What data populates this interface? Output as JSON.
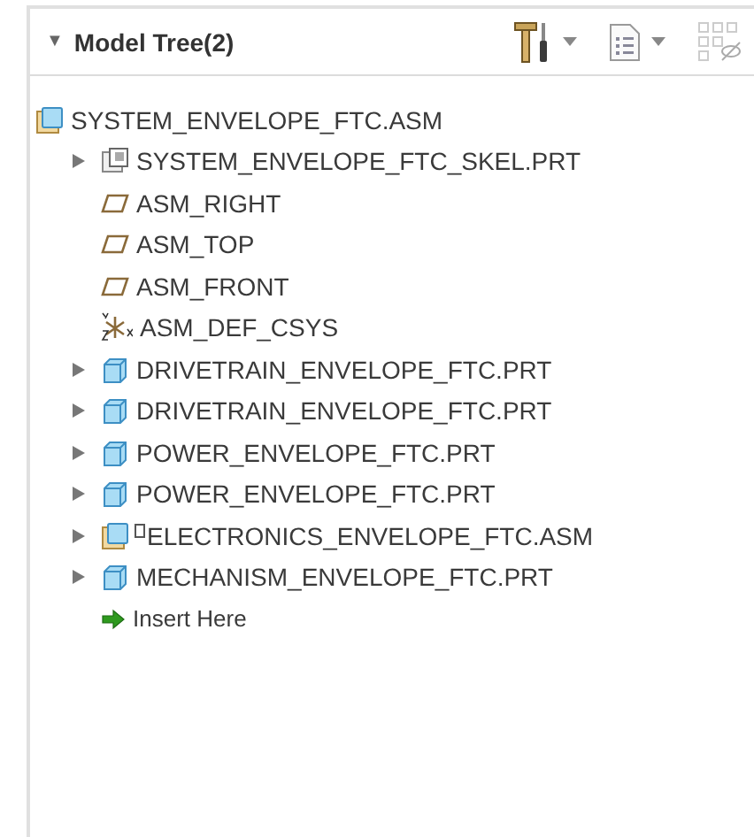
{
  "header": {
    "expand_glyph": "▼",
    "title": "Model Tree(2)",
    "collapsed": false
  },
  "tree": {
    "label": "SYSTEM_ENVELOPE_FTC.ASM",
    "kind": "assembly",
    "children": [
      {
        "label": "SYSTEM_ENVELOPE_FTC_SKEL.PRT",
        "kind": "skeleton",
        "collapsed": true,
        "flag": false
      },
      {
        "label": "ASM_RIGHT",
        "kind": "plane",
        "collapsed": false,
        "flag": false
      },
      {
        "label": "ASM_TOP",
        "kind": "plane",
        "collapsed": false,
        "flag": false
      },
      {
        "label": "ASM_FRONT",
        "kind": "plane",
        "collapsed": false,
        "flag": false
      },
      {
        "label": "ASM_DEF_CSYS",
        "kind": "csys",
        "collapsed": false,
        "flag": false
      },
      {
        "label": "DRIVETRAIN_ENVELOPE_FTC.PRT",
        "kind": "part",
        "collapsed": true,
        "flag": false
      },
      {
        "label": "DRIVETRAIN_ENVELOPE_FTC.PRT",
        "kind": "part",
        "collapsed": true,
        "flag": false
      },
      {
        "label": "POWER_ENVELOPE_FTC.PRT",
        "kind": "part",
        "collapsed": true,
        "flag": false
      },
      {
        "label": "POWER_ENVELOPE_FTC.PRT",
        "kind": "part",
        "collapsed": true,
        "flag": false
      },
      {
        "label": "ELECTRONICS_ENVELOPE_FTC.ASM",
        "kind": "assembly",
        "collapsed": true,
        "flag": true
      },
      {
        "label": "MECHANISM_ENVELOPE_FTC.PRT",
        "kind": "part",
        "collapsed": true,
        "flag": false
      },
      {
        "label": "Insert Here",
        "kind": "insert",
        "collapsed": false,
        "flag": false
      }
    ]
  }
}
